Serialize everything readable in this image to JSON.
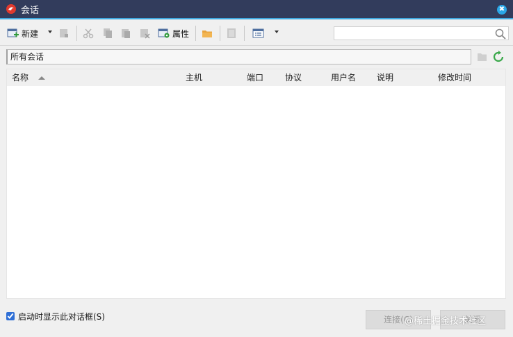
{
  "window": {
    "title": "会话"
  },
  "toolbar": {
    "new_label": "新建",
    "properties_label": "属性"
  },
  "search": {
    "value": "",
    "placeholder": ""
  },
  "path": {
    "current": "所有会话"
  },
  "table": {
    "columns": [
      "名称",
      "主机",
      "端口",
      "协议",
      "用户名",
      "说明",
      "修改时间"
    ],
    "rows": []
  },
  "footer": {
    "show_on_startup_label": "启动时显示此对话框(S)",
    "show_on_startup_checked": true,
    "connect_label": "连接(C)",
    "close_label": "关闭"
  },
  "watermark": "@稀土掘金技术社区",
  "colors": {
    "titlebar": "#323c5c",
    "accent": "#3fa9e0",
    "refresh": "#3aa84a"
  }
}
